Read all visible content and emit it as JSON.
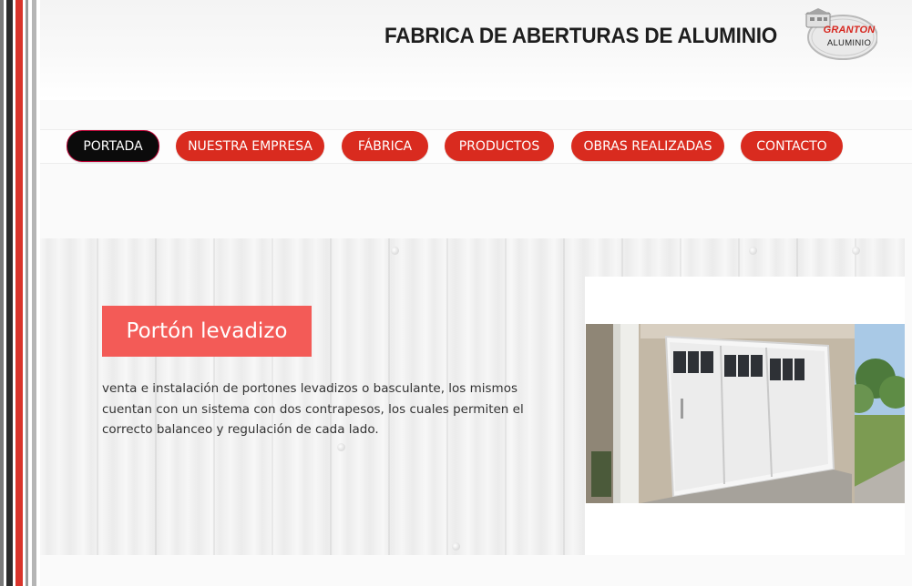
{
  "header": {
    "title": "FABRICA DE ABERTURAS DE ALUMINIO",
    "logo": {
      "brand": "GRANTON",
      "subtitle": "ALUMINIO"
    }
  },
  "nav": {
    "items": [
      {
        "label": "PORTADA",
        "active": true
      },
      {
        "label": "NUESTRA EMPRESA",
        "active": false
      },
      {
        "label": "FÁBRICA",
        "active": false
      },
      {
        "label": "PRODUCTOS",
        "active": false
      },
      {
        "label": "OBRAS REALIZADAS",
        "active": false
      },
      {
        "label": "CONTACTO",
        "active": false
      }
    ]
  },
  "feature": {
    "title": "Portón levadizo",
    "description": "venta e instalación de portones levadizos o basculante, los mismos cuentan con un sistema con dos contrapesos, los cuales permiten el correcto balanceo y regulación de cada lado.",
    "image_icon": "garage-door-photo"
  },
  "colors": {
    "nav_button": "#d92b1f",
    "nav_active": "#0b0b0b",
    "title_tag": "#f35b57",
    "brand_red": "#d7261e"
  }
}
